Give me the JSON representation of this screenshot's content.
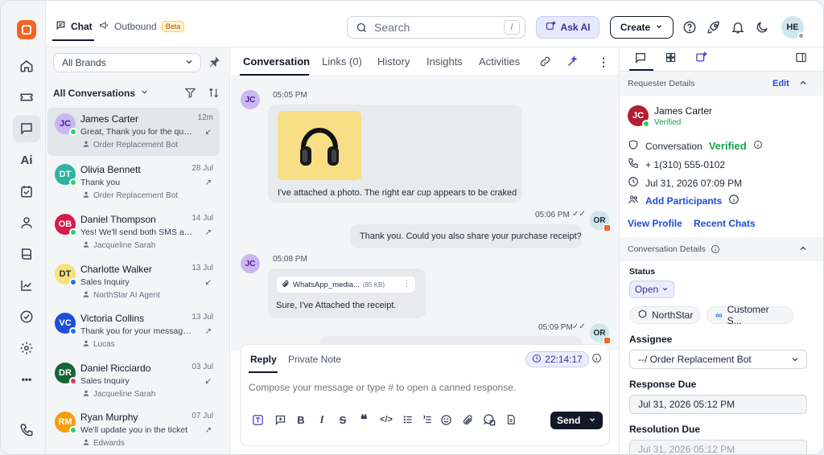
{
  "app": {
    "nav": [
      "home-icon",
      "ticket-icon",
      "chat-icon",
      "ai-icon",
      "task-icon",
      "contacts-icon",
      "knowledge-icon",
      "reports-icon",
      "check-icon",
      "settings-icon",
      "more-icon",
      "phone-icon"
    ],
    "nav_ai_label": "Ai",
    "accent": "#f26522"
  },
  "topbar": {
    "tab_chat": "Chat",
    "tab_outbound": "Outbound",
    "beta_badge": "Beta",
    "search_placeholder": "Search",
    "search_shortcut": "/",
    "ask_ai": "Ask AI",
    "create": "Create",
    "user_initials": "HE"
  },
  "list": {
    "brand_filter": "All Brands",
    "conversations_filter": "All Conversations",
    "items": [
      {
        "initials": "JC",
        "name": "James Carter",
        "time": "12m",
        "message": "Great, Thank you for the quick...",
        "agent": "Order Replacement Bot",
        "avatar_color": "#c9b8f0",
        "avatar_text_color": "#4c1d95",
        "channel_color": "#25d366",
        "direction": "↙"
      },
      {
        "initials": "DT",
        "name": "Olivia Bennett",
        "time": "28 Jul",
        "message": "Thank you",
        "agent": "Order Replacement Bot",
        "avatar_color": "#2bb5a0",
        "avatar_text_color": "#ffffff",
        "channel_color": "#25d366",
        "direction": "↗"
      },
      {
        "initials": "OB",
        "name": "Daniel Thompson",
        "time": "14 Jul",
        "message": "Yes! We'll send both SMS and...",
        "agent": "Jacqueline Sarah",
        "avatar_color": "#d81b4a",
        "avatar_text_color": "#ffffff",
        "channel_color": "#25d366",
        "direction": "↗"
      },
      {
        "initials": "DT",
        "name": "Charlotte Walker",
        "time": "13 Jul",
        "message": "Sales Inquiry",
        "agent": "NorthStar AI Agent",
        "avatar_color": "#f6e27a",
        "avatar_text_color": "#1f2937",
        "channel_color": "#1877f2",
        "direction": "↙"
      },
      {
        "initials": "VC",
        "name": "Victoria Collins",
        "time": "13 Jul",
        "message": "Thank you for your message....",
        "agent": "Lucas",
        "avatar_color": "#1d4ed8",
        "avatar_text_color": "#ffffff",
        "channel_color": "#1877f2",
        "direction": "↗"
      },
      {
        "initials": "DR",
        "name": "Daniel Ricciardo",
        "time": "03 Jul",
        "message": "Sales Inquiry",
        "agent": "Jacqueline Sarah",
        "avatar_color": "#166534",
        "avatar_text_color": "#ffffff",
        "channel_color": "#e1306c",
        "direction": "↙"
      },
      {
        "initials": "RM",
        "name": "Ryan Murphy",
        "time": "07 Jul",
        "message": "We'll update you in the ticket",
        "agent": "Edwards",
        "avatar_color": "#f59e0b",
        "avatar_text_color": "#ffffff",
        "channel_color": "#25d366",
        "direction": "↗"
      }
    ]
  },
  "conversation": {
    "tabs": [
      "Conversation",
      "Links (0)",
      "History",
      "Insights",
      "Activities"
    ],
    "messages": {
      "m1_initials": "JC",
      "m1_time": "05:05 PM",
      "m1_text": "I've attached a photo. The right ear cup appears to be craked",
      "m2_initials": "OR",
      "m2_time": "05:06 PM",
      "m2_text": "Thank you. Could you also share your purchase receipt?",
      "m3_initials": "JC",
      "m3_time": "05:08 PM",
      "m3_file_name": "WhatsApp_media...",
      "m3_file_size": "(85 KB)",
      "m3_text": "Sure, I've Attached the receipt.",
      "m4_initials": "OR",
      "m4_time": "05:09 PM"
    },
    "composer": {
      "tab_reply": "Reply",
      "tab_note": "Private Note",
      "timer": "22:14:17",
      "placeholder": "Compose your message or type # to open a canned response.",
      "send": "Send"
    }
  },
  "details": {
    "requester_header": "Requester Details",
    "edit": "Edit",
    "requester_initials": "JC",
    "requester_name": "James Carter",
    "requester_status": "Verified",
    "conversation_label": "Conversation",
    "conversation_verified": "Verified",
    "phone": "+ 1(310) 555-0102",
    "datetime": "Jul 31, 2026 07:09 PM",
    "add_participants": "Add Participants",
    "view_profile": "View Profile",
    "recent_chats": "Recent Chats",
    "conv_details_header": "Conversation Details",
    "status_label": "Status",
    "status_value": "Open",
    "brand_chip": "NorthStar",
    "channel_chip": "Customer S...",
    "assignee_label": "Assignee",
    "assignee_value": "--/ Order Replacement Bot",
    "response_due_label": "Response Due",
    "response_due_value": "Jul 31, 2026 05:12 PM",
    "resolution_due_label": "Resolution Due",
    "resolution_due_value": "Jul 31, 2026 05:12 PM"
  }
}
